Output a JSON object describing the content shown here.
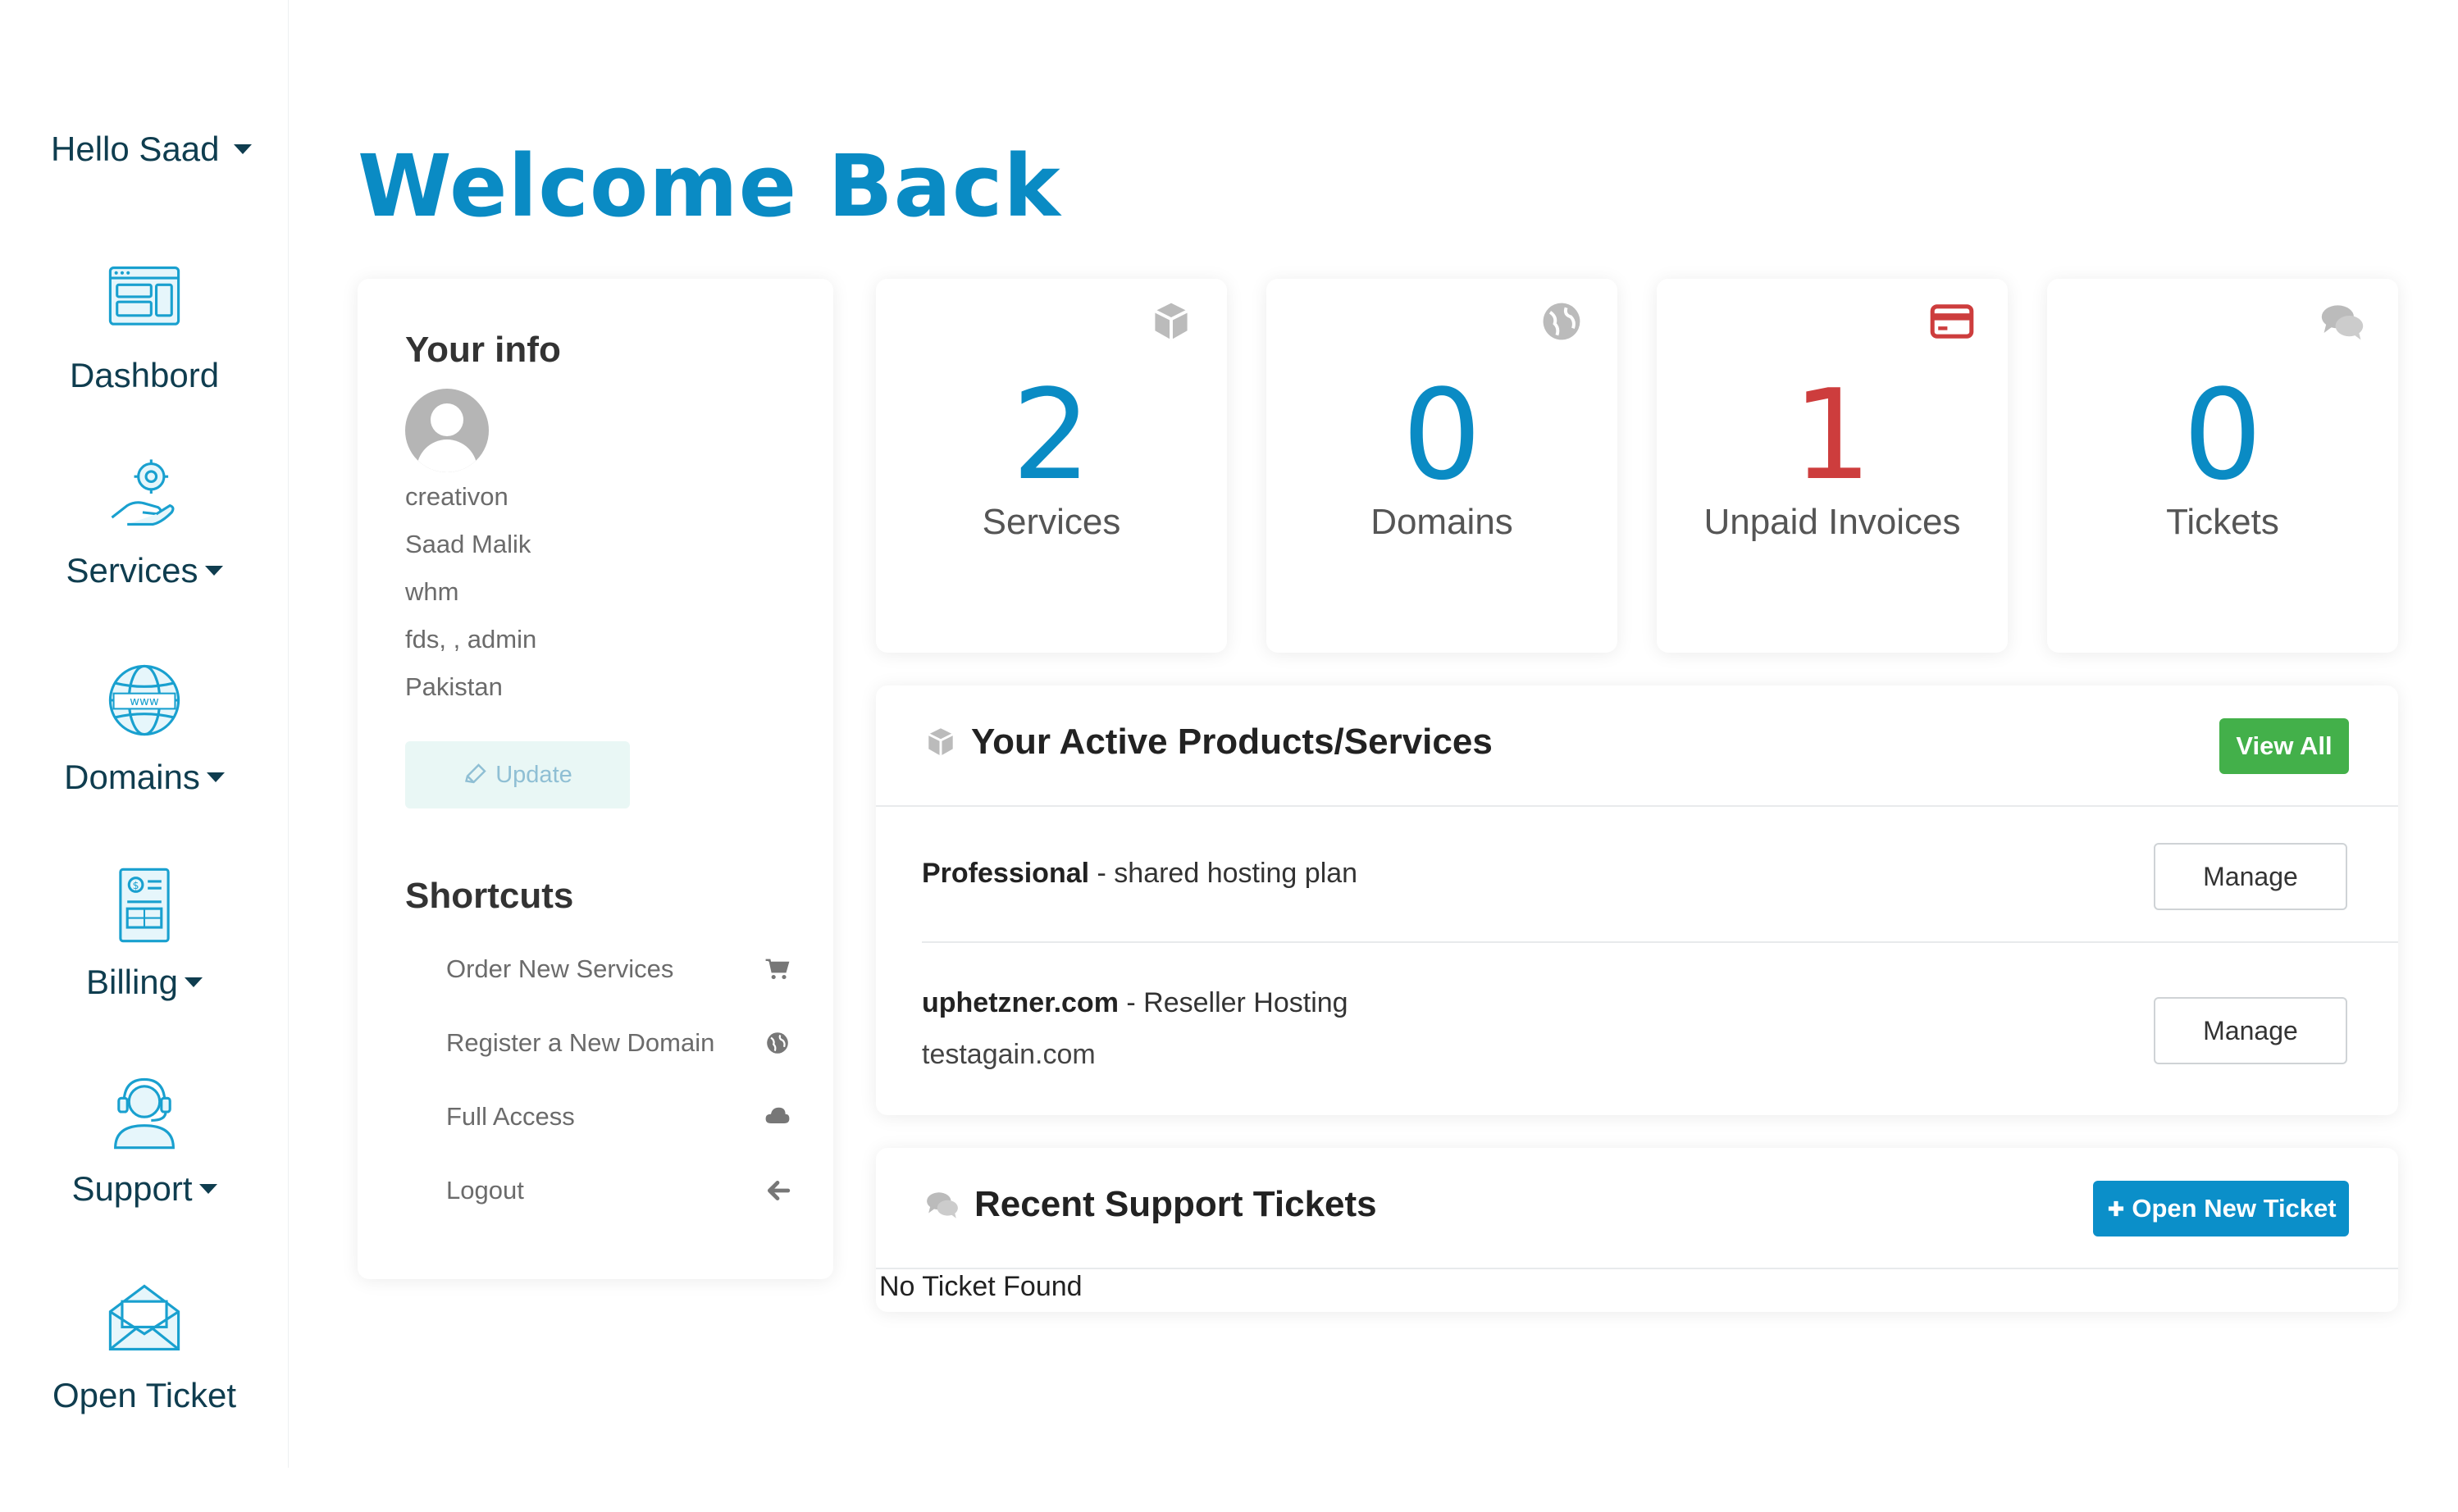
{
  "sidebar": {
    "greeting": "Hello Saad",
    "items": [
      {
        "label": "Dashbord",
        "icon": "dashboard-icon"
      },
      {
        "label": "Services",
        "icon": "services-icon"
      },
      {
        "label": "Domains",
        "icon": "globe-www-icon"
      },
      {
        "label": "Billing",
        "icon": "billing-icon"
      },
      {
        "label": "Support",
        "icon": "headset-icon"
      },
      {
        "label": "Open Ticket",
        "icon": "envelope-icon"
      }
    ]
  },
  "page": {
    "title": "Welcome Back"
  },
  "info": {
    "title": "Your info",
    "lines": [
      "creativon",
      "Saad Malik",
      "whm",
      "fds, , admin",
      "Pakistan"
    ],
    "update_label": "Update"
  },
  "shortcuts": {
    "title": "Shortcuts",
    "items": [
      {
        "label": "Order New Services",
        "icon": "cart-icon"
      },
      {
        "label": "Register a New Domain",
        "icon": "globe-icon"
      },
      {
        "label": "Full Access",
        "icon": "cloud-icon"
      },
      {
        "label": "Logout",
        "icon": "arrow-left-icon"
      }
    ]
  },
  "stats": [
    {
      "value": "2",
      "label": "Services",
      "icon": "cube-icon"
    },
    {
      "value": "0",
      "label": "Domains",
      "icon": "globe-icon"
    },
    {
      "value": "1",
      "label": "Unpaid Invoices",
      "icon": "credit-card-icon"
    },
    {
      "value": "0",
      "label": "Tickets",
      "icon": "comments-icon"
    }
  ],
  "products": {
    "title": "Your Active Products/Services",
    "view_all": "View All",
    "rows": [
      {
        "name": "Professional",
        "desc": " - shared hosting plan",
        "sub": "",
        "manage": "Manage"
      },
      {
        "name": "uphetzner.com",
        "desc": " - Reseller Hosting",
        "sub": "testagain.com",
        "manage": "Manage"
      }
    ]
  },
  "tickets": {
    "title": "Recent Support Tickets",
    "open_new": "Open New Ticket",
    "empty": "No Ticket Found"
  },
  "colors": {
    "accent": "#0a8bc4",
    "danger": "#cd3d3d",
    "success": "#43b04a",
    "nav_text": "#0f3d4f"
  }
}
